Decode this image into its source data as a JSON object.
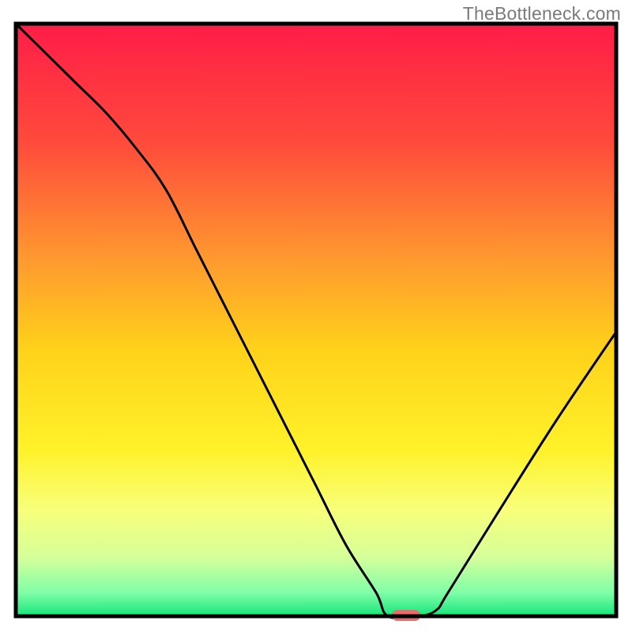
{
  "watermark": "TheBottleneck.com",
  "chart_data": {
    "type": "line",
    "title": "",
    "xlabel": "",
    "ylabel": "",
    "xlim": [
      0,
      100
    ],
    "ylim": [
      0,
      100
    ],
    "series": [
      {
        "name": "bottleneck-curve",
        "x": [
          0,
          5,
          10,
          15,
          20,
          25,
          30,
          35,
          40,
          45,
          50,
          55,
          60,
          62,
          67,
          70,
          72,
          80,
          90,
          100
        ],
        "values": [
          100,
          95,
          90,
          85,
          79,
          72,
          62,
          52,
          42,
          32,
          22,
          12,
          4,
          0,
          0,
          1,
          4,
          17,
          33,
          48
        ]
      }
    ],
    "marker": {
      "x": 65,
      "y": 0
    },
    "background": {
      "type": "vertical-gradient",
      "stops": [
        {
          "pct": 0,
          "color": "#ff1d47"
        },
        {
          "pct": 20,
          "color": "#ff4a3c"
        },
        {
          "pct": 40,
          "color": "#ff9a2f"
        },
        {
          "pct": 55,
          "color": "#ffd21a"
        },
        {
          "pct": 72,
          "color": "#fff22a"
        },
        {
          "pct": 82,
          "color": "#f8ff7a"
        },
        {
          "pct": 90,
          "color": "#d6ff9a"
        },
        {
          "pct": 96,
          "color": "#7fffa8"
        },
        {
          "pct": 100,
          "color": "#14e57a"
        }
      ]
    },
    "frame_color": "#000000",
    "curve_color": "#000000",
    "marker_color": "#e86d6d"
  }
}
